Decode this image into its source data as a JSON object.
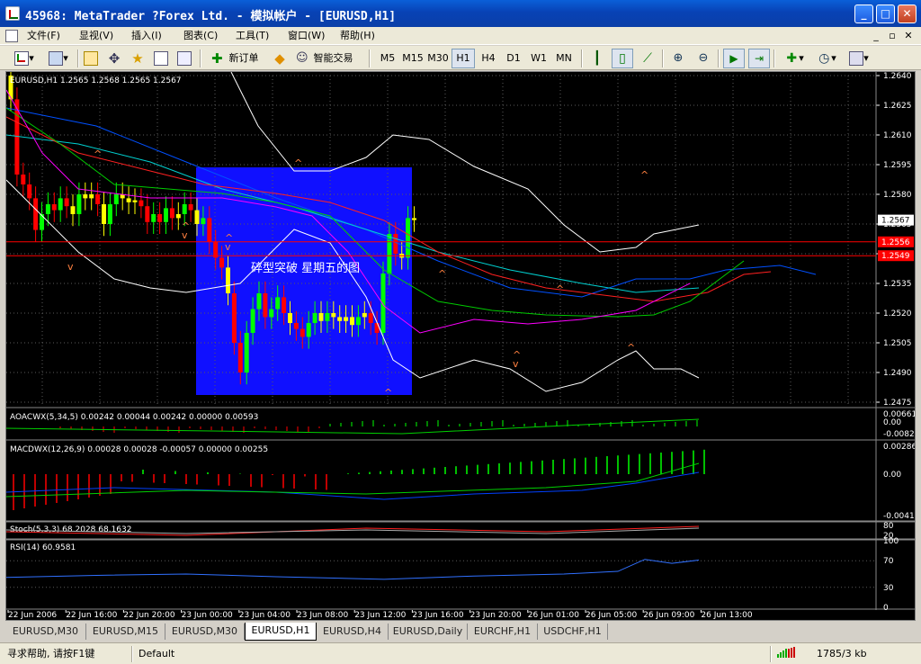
{
  "window": {
    "title": "45968: MetaTrader ?Forex Ltd. - 模拟帐户 - [EURUSD,H1]"
  },
  "menu": {
    "items": [
      "文件(F)",
      "显视(V)",
      "插入(I)",
      "图表(C)",
      "工具(T)",
      "窗口(W)",
      "帮助(H)"
    ]
  },
  "toolbar": {
    "new_order": "新订单",
    "expert_advisors": "智能交易",
    "timeframes": [
      "M5",
      "M15",
      "M30",
      "H1",
      "H4",
      "D1",
      "W1",
      "MN"
    ],
    "active_timeframe": "H1"
  },
  "chart": {
    "symbol_header": "EURUSD,H1  1.2565 1.2568 1.2565 1.2567",
    "annotation": "碎型突破 星期五的图",
    "current_price": "1.2567",
    "red_line_1": "1.2556",
    "red_line_2": "1.2549",
    "price_ticks": [
      "1.2640",
      "1.2625",
      "1.2610",
      "1.2595",
      "1.2580",
      "1.2565",
      "1.2550",
      "1.2535",
      "1.2520",
      "1.2505",
      "1.2490",
      "1.2475"
    ],
    "time_ticks": [
      "22 Jun 2006",
      "22 Jun 16:00",
      "22 Jun 20:00",
      "23 Jun 00:00",
      "23 Jun 04:00",
      "23 Jun 08:00",
      "23 Jun 12:00",
      "23 Jun 16:00",
      "23 Jun 20:00",
      "26 Jun 01:00",
      "26 Jun 05:00",
      "26 Jun 09:00",
      "26 Jun 13:00"
    ]
  },
  "indicators": {
    "aoac": {
      "label": "AOACWX(5,34,5) 0.00242 0.00044 0.00242 0.00000 0.00593",
      "scale": [
        "0.00661",
        "0.00",
        "-0.00822"
      ]
    },
    "macd": {
      "label": "MACDWX(12,26,9) 0.00028 0.00028 -0.00057 0.00000 0.00255",
      "scale": [
        "0.00286",
        "0.00",
        "-0.00411"
      ]
    },
    "stoch": {
      "label": "Stoch(5,3,3) 68.2028 68.1632",
      "scale": [
        "80",
        "20"
      ]
    },
    "rsi": {
      "label": "RSI(14) 60.9581",
      "scale": [
        "100",
        "70",
        "30",
        "0"
      ]
    }
  },
  "tabs": [
    {
      "label": "EURUSD,M30",
      "active": false
    },
    {
      "label": "EURUSD,M15",
      "active": false
    },
    {
      "label": "EURUSD,M30",
      "active": false
    },
    {
      "label": "EURUSD,H1",
      "active": true
    },
    {
      "label": "EURUSD,H4",
      "active": false
    },
    {
      "label": "EURUSD,Daily",
      "active": false
    },
    {
      "label": "EURCHF,H1",
      "active": false
    },
    {
      "label": "USDCHF,H1",
      "active": false
    }
  ],
  "status": {
    "help": "寻求帮助, 请按F1键",
    "profile": "Default",
    "traffic": "1785/3 kb"
  },
  "colors": {
    "bg": "#000000",
    "bull": "#00ff00",
    "bear": "#ff0000",
    "doji": "#ffff00",
    "grid": "#5a5a5a",
    "highlight": "#1010ff"
  }
}
